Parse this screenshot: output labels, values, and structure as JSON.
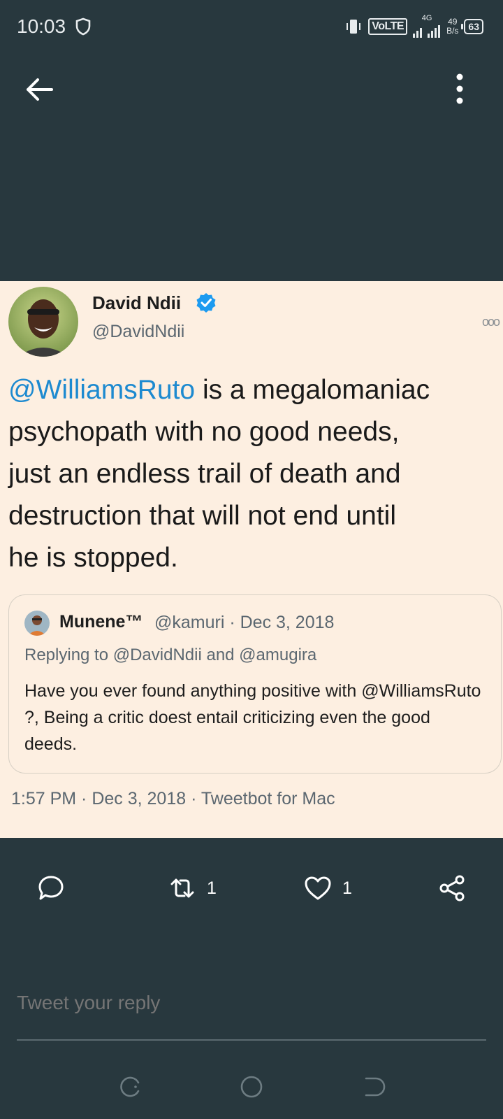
{
  "status_bar": {
    "time": "10:03",
    "network_type": "4G",
    "volte": "VoLTE",
    "speed_value": "49",
    "speed_unit": "B/s",
    "battery": "63"
  },
  "tweet": {
    "author_name": "David Ndii",
    "author_handle": "@DavidNdii",
    "verified": true,
    "text_lines": [
      {
        "mention": "@WilliamsRuto",
        "rest": " is a megalomaniac"
      },
      {
        "mention": "",
        "rest": "psychopath with no good needs,"
      },
      {
        "mention": "",
        "rest": "just an endless trail of death and"
      },
      {
        "mention": "",
        "rest": "destruction that will not end until"
      },
      {
        "mention": "",
        "rest": "he is stopped."
      }
    ],
    "quote": {
      "name": "Munene™",
      "handle_date": "@kamuri · Dec 3, 2018",
      "replying_to": "Replying to @DavidNdii and @amugira",
      "text": "Have you ever found anything positive with @WilliamsRuto ?, Being a critic doest entail criticizing even the good deeds."
    },
    "meta": "1:57 PM · Dec 3, 2018 · Tweetbot for Mac"
  },
  "actions": {
    "retweet_count": "1",
    "like_count": "1"
  },
  "reply": {
    "placeholder": "Tweet your reply"
  },
  "colors": {
    "background": "#28383e",
    "card": "#fdefe1",
    "mention": "#1d8ad0",
    "verified": "#1d9bf0"
  }
}
